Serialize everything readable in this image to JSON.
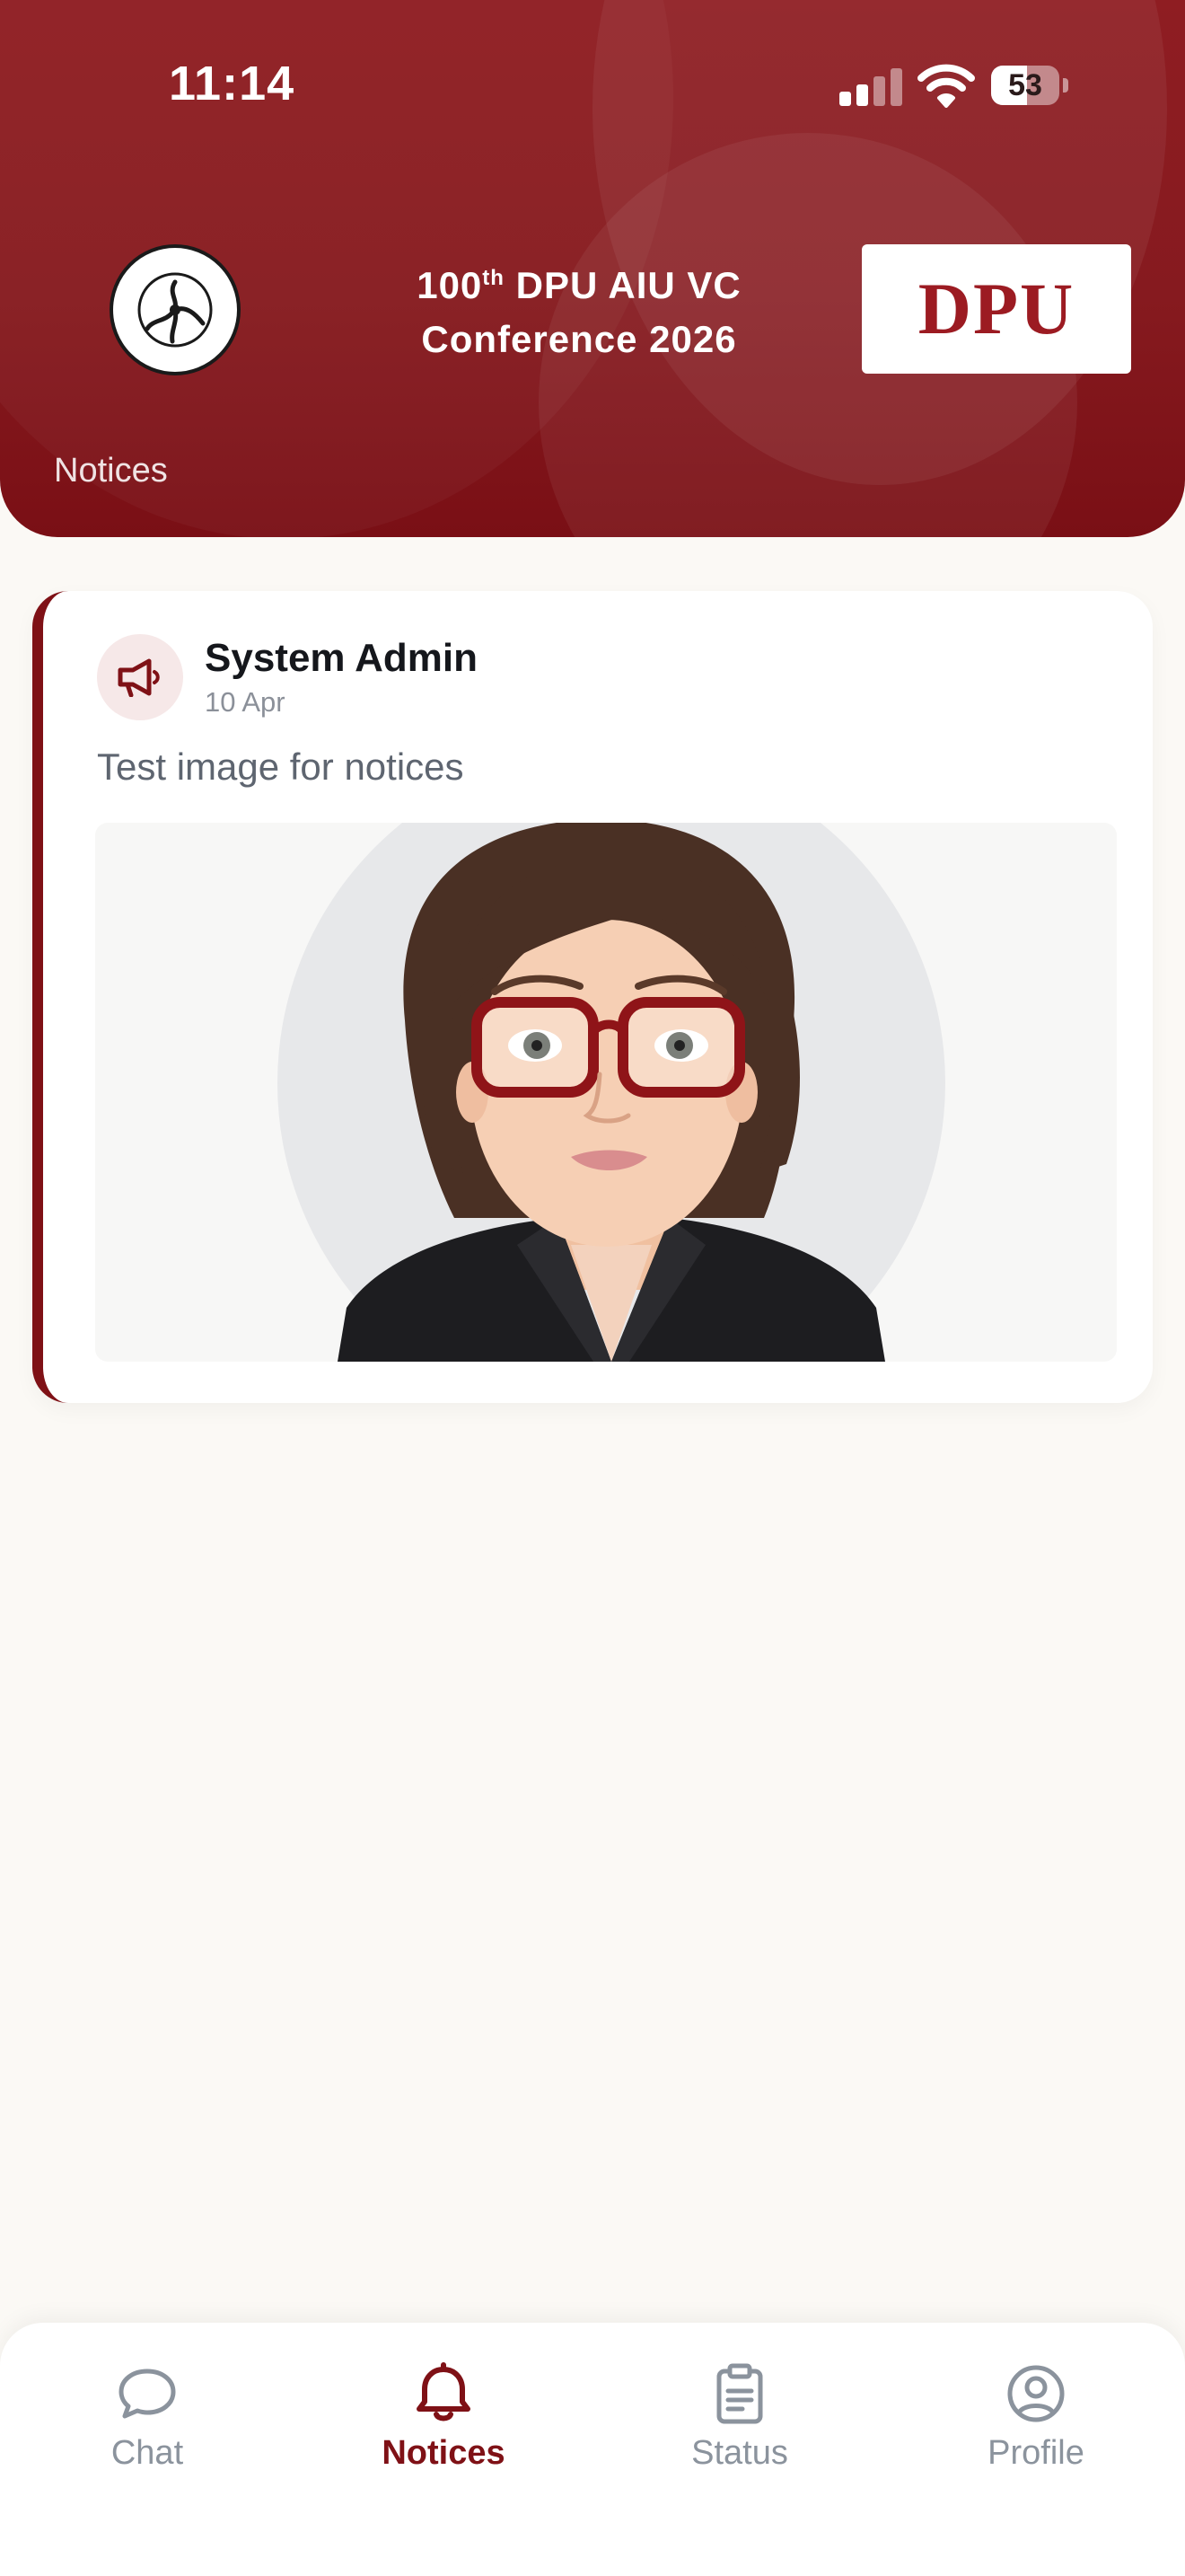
{
  "status_bar": {
    "time": "11:14",
    "battery": "53",
    "battery_level": 0.53
  },
  "header": {
    "conference_title_prefix": "100",
    "conference_title_sup": "th",
    "conference_title_line1_rest": " DPU AIU VC",
    "conference_title_line2": "Conference 2026",
    "left_logo": "association-of-indian-universities-logo",
    "right_logo_text": "DPU",
    "page_label": "Notices"
  },
  "notice": {
    "author": "System Admin",
    "date": "10 Apr",
    "text": "Test image for notices",
    "icon": "megaphone-icon",
    "image": "cartoon-woman-avatar"
  },
  "nav": {
    "items": [
      {
        "label": "Chat",
        "icon": "chat-bubble-icon",
        "active": false
      },
      {
        "label": "Notices",
        "icon": "bell-icon",
        "active": true
      },
      {
        "label": "Status",
        "icon": "clipboard-icon",
        "active": false
      },
      {
        "label": "Profile",
        "icon": "user-circle-icon",
        "active": false
      }
    ]
  },
  "colors": {
    "brand": "#8f1d22",
    "accent": "#7f1116",
    "background": "#fbf9f5",
    "inactive": "#8b939d"
  }
}
